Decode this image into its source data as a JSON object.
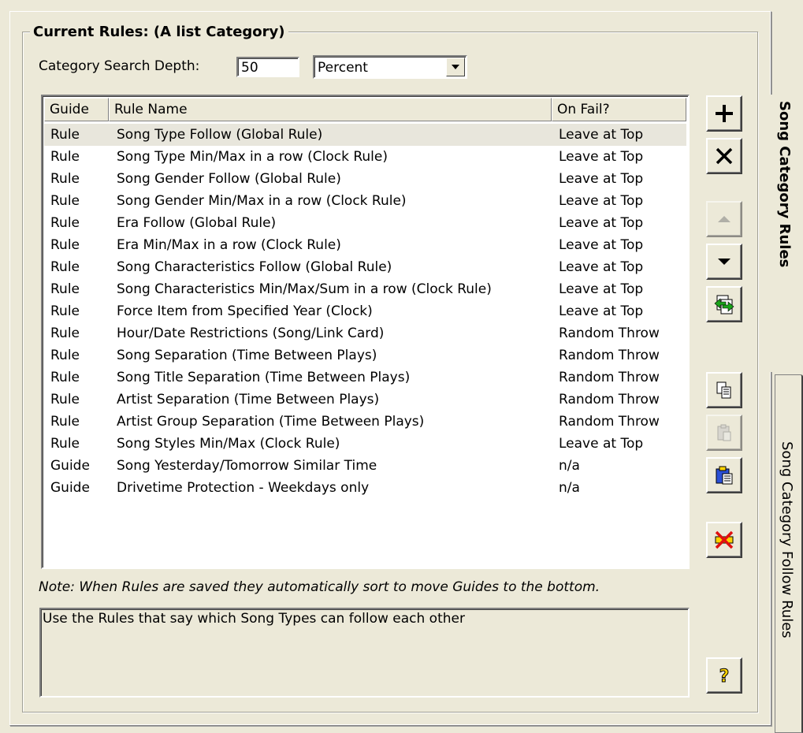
{
  "group_title": "Current Rules: (A list Category)",
  "search_depth": {
    "label": "Category Search Depth:",
    "value": "50",
    "unit": "Percent"
  },
  "columns": [
    "Guide",
    "Rule Name",
    "On Fail?"
  ],
  "rows": [
    {
      "guide": "Rule",
      "name": "Song Type Follow (Global Rule)",
      "on_fail": "Leave at Top"
    },
    {
      "guide": "Rule",
      "name": "Song Type Min/Max in a row (Clock Rule)",
      "on_fail": "Leave at Top"
    },
    {
      "guide": "Rule",
      "name": "Song Gender Follow (Global Rule)",
      "on_fail": "Leave at Top"
    },
    {
      "guide": "Rule",
      "name": "Song Gender Min/Max in a row (Clock Rule)",
      "on_fail": "Leave at Top"
    },
    {
      "guide": "Rule",
      "name": "Era Follow (Global Rule)",
      "on_fail": "Leave at Top"
    },
    {
      "guide": "Rule",
      "name": "Era Min/Max in a row (Clock Rule)",
      "on_fail": "Leave at Top"
    },
    {
      "guide": "Rule",
      "name": "Song Characteristics Follow (Global Rule)",
      "on_fail": "Leave at Top"
    },
    {
      "guide": "Rule",
      "name": "Song Characteristics Min/Max/Sum in a row (Clock Rule)",
      "on_fail": "Leave at Top"
    },
    {
      "guide": "Rule",
      "name": "Force Item from Specified Year (Clock)",
      "on_fail": "Leave at Top"
    },
    {
      "guide": "Rule",
      "name": "Hour/Date Restrictions (Song/Link Card)",
      "on_fail": "Random Throw"
    },
    {
      "guide": "Rule",
      "name": "Song Separation (Time Between Plays)",
      "on_fail": "Random Throw"
    },
    {
      "guide": "Rule",
      "name": "Song Title Separation (Time Between Plays)",
      "on_fail": "Random Throw"
    },
    {
      "guide": "Rule",
      "name": "Artist Separation (Time Between Plays)",
      "on_fail": "Random Throw"
    },
    {
      "guide": "Rule",
      "name": "Artist Group Separation (Time Between Plays)",
      "on_fail": "Random Throw"
    },
    {
      "guide": "Rule",
      "name": "Song Styles Min/Max (Clock Rule)",
      "on_fail": "Leave at Top"
    },
    {
      "guide": "Guide",
      "name": "Song Yesterday/Tomorrow Similar Time",
      "on_fail": "n/a"
    },
    {
      "guide": "Guide",
      "name": "Drivetime Protection - Weekdays only",
      "on_fail": "n/a"
    }
  ],
  "selected_row": 0,
  "note": "Note: When Rules are saved they automatically sort to move Guides to the bottom.",
  "description": "Use the Rules that say which Song Types can follow each other",
  "toolbar": [
    {
      "name": "add-rule-button",
      "icon": "plus-icon"
    },
    {
      "name": "delete-rule-button",
      "icon": "x-icon"
    },
    {
      "name": "move-up-button",
      "icon": "up-arrow-icon",
      "disabled": true
    },
    {
      "name": "move-down-button",
      "icon": "down-arrow-icon"
    },
    {
      "name": "swap-button",
      "icon": "swap-icon"
    },
    {
      "name": "copy-button",
      "icon": "copy-icon"
    },
    {
      "name": "paste-button",
      "icon": "paste-icon",
      "disabled": true
    },
    {
      "name": "paste-special-button",
      "icon": "paste-special-icon"
    },
    {
      "name": "clear-button",
      "icon": "clear-icon"
    },
    {
      "name": "help-button",
      "icon": "help-icon"
    }
  ],
  "tabs": {
    "active": "Song Category Rules",
    "inactive": "Song Category Follow Rules"
  }
}
